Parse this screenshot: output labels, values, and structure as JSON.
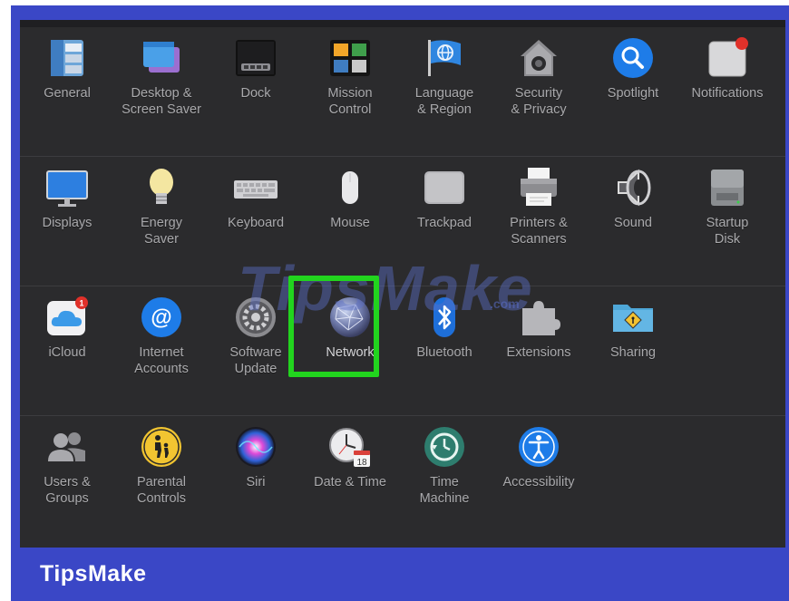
{
  "brand": "TipsMake",
  "watermark": {
    "main": "TipsMake",
    "sub": ".com"
  },
  "colors": {
    "accent": "#3a47c6",
    "highlight": "#22d41e",
    "panel": "#2b2b2d",
    "label": "#a9a9ac"
  },
  "rows": [
    [
      {
        "label": "General",
        "icon": "general-icon"
      },
      {
        "label": "Desktop &\nScreen Saver",
        "icon": "desktop-screensaver-icon"
      },
      {
        "label": "Dock",
        "icon": "dock-icon"
      },
      {
        "label": "Mission\nControl",
        "icon": "mission-control-icon"
      },
      {
        "label": "Language\n& Region",
        "icon": "language-region-icon"
      },
      {
        "label": "Security\n& Privacy",
        "icon": "security-privacy-icon"
      },
      {
        "label": "Spotlight",
        "icon": "spotlight-icon"
      },
      {
        "label": "Notifications",
        "icon": "notifications-icon"
      }
    ],
    [
      {
        "label": "Displays",
        "icon": "displays-icon"
      },
      {
        "label": "Energy\nSaver",
        "icon": "energy-saver-icon"
      },
      {
        "label": "Keyboard",
        "icon": "keyboard-icon"
      },
      {
        "label": "Mouse",
        "icon": "mouse-icon"
      },
      {
        "label": "Trackpad",
        "icon": "trackpad-icon"
      },
      {
        "label": "Printers &\nScanners",
        "icon": "printer-icon"
      },
      {
        "label": "Sound",
        "icon": "sound-icon"
      },
      {
        "label": "Startup\nDisk",
        "icon": "startup-disk-icon"
      }
    ],
    [
      {
        "label": "iCloud",
        "icon": "icloud-icon",
        "badge": "1"
      },
      {
        "label": "Internet\nAccounts",
        "icon": "internet-accounts-icon"
      },
      {
        "label": "Software\nUpdate",
        "icon": "software-update-icon"
      },
      {
        "label": "Network",
        "icon": "network-icon",
        "highlighted": true
      },
      {
        "label": "Bluetooth",
        "icon": "bluetooth-icon"
      },
      {
        "label": "Extensions",
        "icon": "extensions-icon"
      },
      {
        "label": "Sharing",
        "icon": "sharing-icon"
      }
    ],
    [
      {
        "label": "Users &\nGroups",
        "icon": "users-groups-icon"
      },
      {
        "label": "Parental\nControls",
        "icon": "parental-controls-icon"
      },
      {
        "label": "Siri",
        "icon": "siri-icon"
      },
      {
        "label": "Date & Time",
        "icon": "date-time-icon",
        "calendar_day": "18"
      },
      {
        "label": "Time\nMachine",
        "icon": "time-machine-icon"
      },
      {
        "label": "Accessibility",
        "icon": "accessibility-icon"
      }
    ]
  ]
}
